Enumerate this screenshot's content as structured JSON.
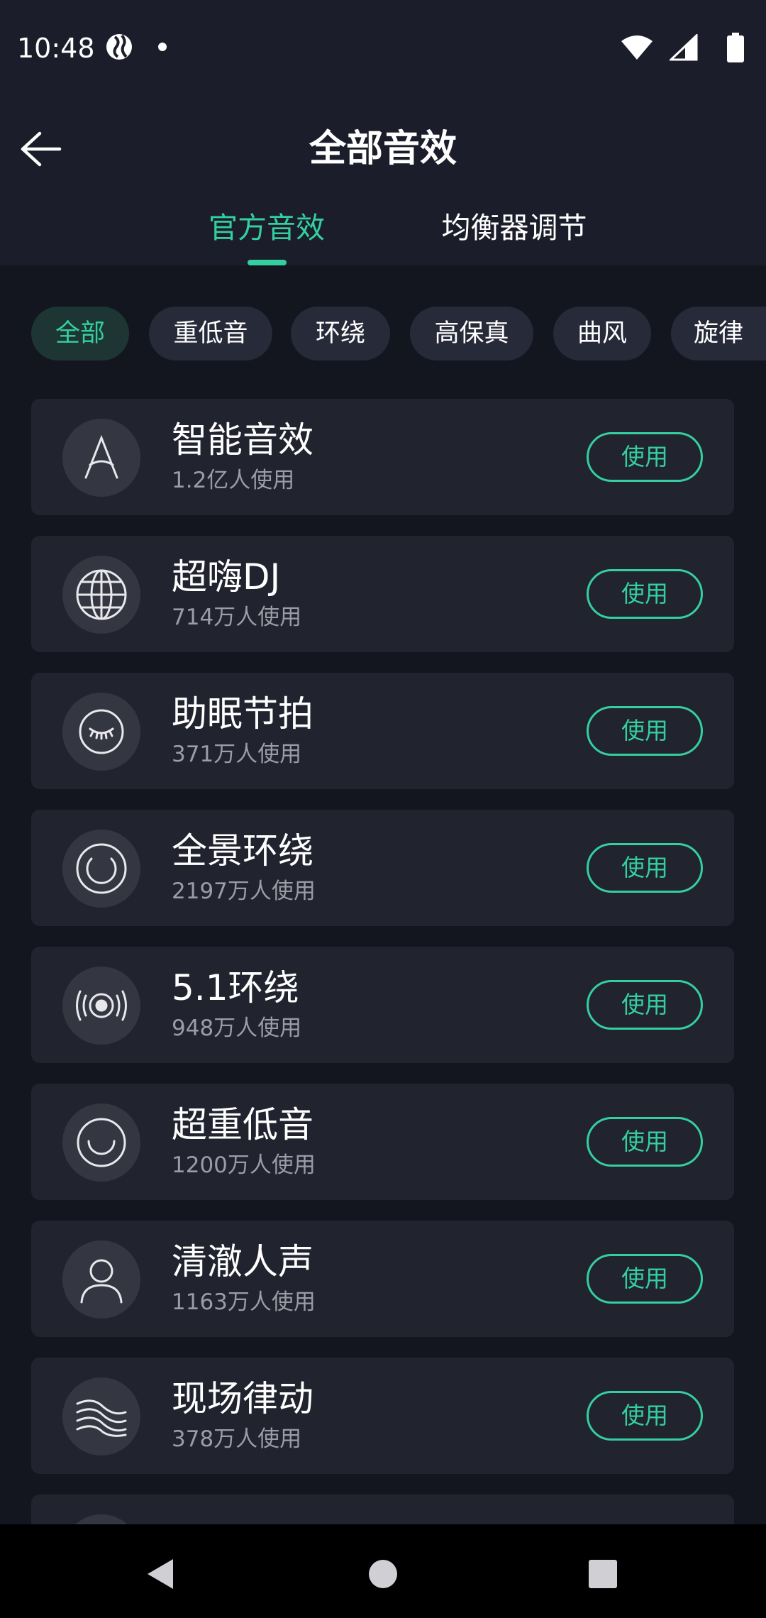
{
  "status_bar": {
    "time": "10:48",
    "left_icons": [
      "vpn-globe-icon",
      "notification-dot-icon"
    ],
    "right_icons": [
      "wifi-icon",
      "cellular-signal-icon",
      "battery-icon"
    ]
  },
  "header": {
    "title": "全部音效",
    "back_icon": "arrow-left-icon"
  },
  "tabs": [
    {
      "label": "官方音效",
      "active": true
    },
    {
      "label": "均衡器调节",
      "active": false
    }
  ],
  "chips": [
    {
      "label": "全部",
      "active": true
    },
    {
      "label": "重低音",
      "active": false
    },
    {
      "label": "环绕",
      "active": false
    },
    {
      "label": "高保真",
      "active": false
    },
    {
      "label": "曲风",
      "active": false
    },
    {
      "label": "旋律",
      "active": false
    }
  ],
  "effects": [
    {
      "title": "智能音效",
      "users": "1.2亿人使用",
      "icon": "a-letter-icon",
      "button": "使用"
    },
    {
      "title": "超嗨DJ",
      "users": "714万人使用",
      "icon": "globe-icon",
      "button": "使用"
    },
    {
      "title": "助眠节拍",
      "users": "371万人使用",
      "icon": "sleep-eye-icon",
      "button": "使用"
    },
    {
      "title": "全景环绕",
      "users": "2197万人使用",
      "icon": "surround-icon",
      "button": "使用"
    },
    {
      "title": "5.1环绕",
      "users": "948万人使用",
      "icon": "speaker-waves-icon",
      "button": "使用"
    },
    {
      "title": "超重低音",
      "users": "1200万人使用",
      "icon": "smile-circle-icon",
      "button": "使用"
    },
    {
      "title": "清澈人声",
      "users": "1163万人使用",
      "icon": "person-icon",
      "button": "使用"
    },
    {
      "title": "现场律动",
      "users": "378万人使用",
      "icon": "wave-lines-icon",
      "button": "使用"
    }
  ],
  "colors": {
    "accent": "#34cfa0",
    "background": "#13151f",
    "header_bg": "#1b1d2a",
    "card_bg": "#21232f"
  },
  "nav_bar": {
    "buttons": [
      "back-triangle-icon",
      "home-circle-icon",
      "recents-square-icon"
    ]
  }
}
